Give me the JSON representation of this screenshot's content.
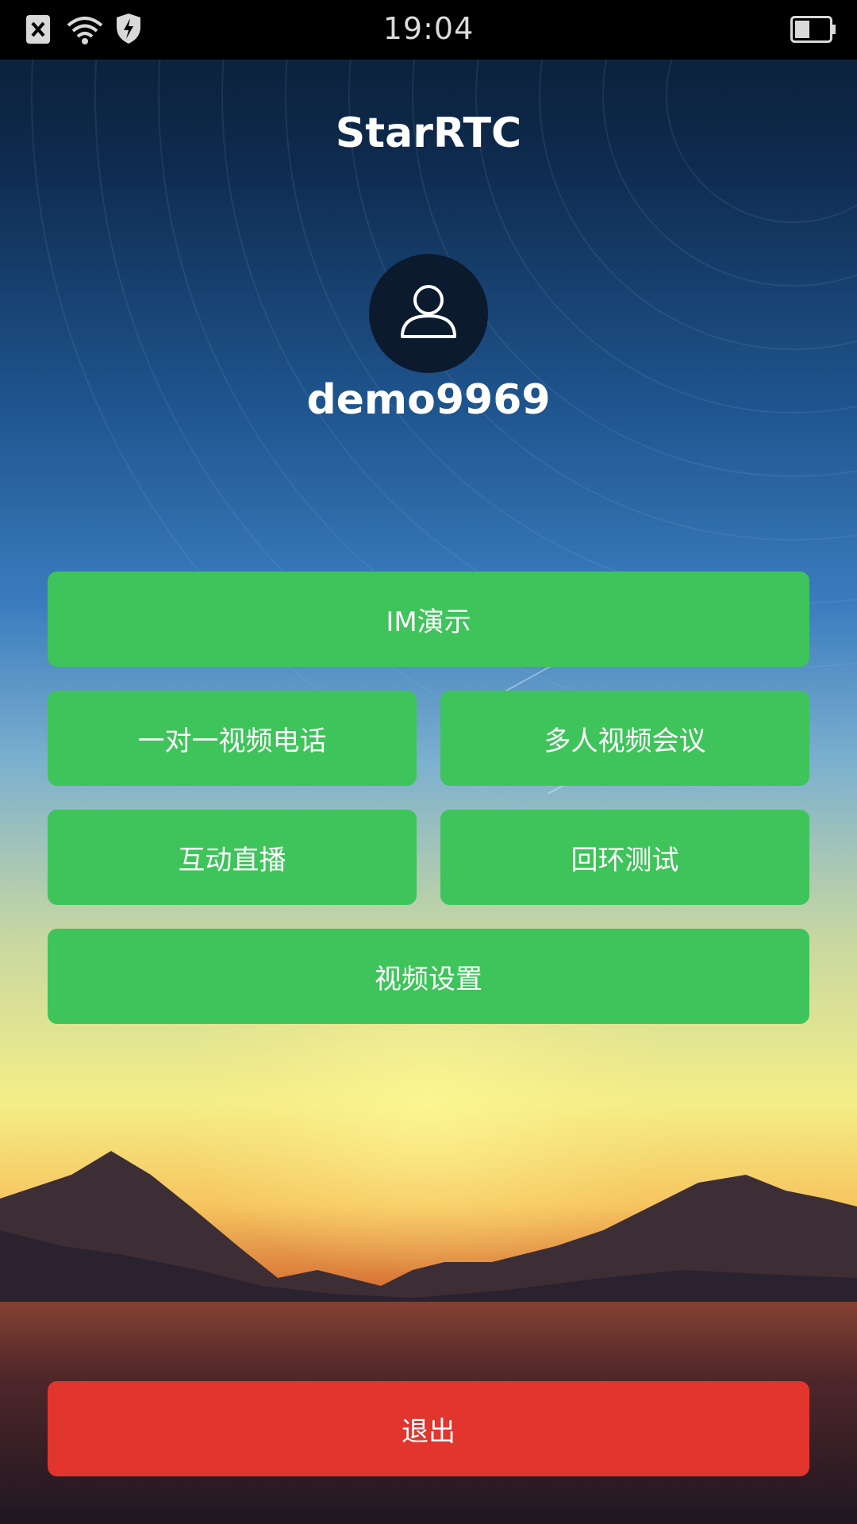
{
  "status_bar": {
    "time": "19:04",
    "icons": [
      "close-notification-icon",
      "wifi-icon",
      "shield-bolt-icon",
      "battery-icon"
    ]
  },
  "app": {
    "title": "StarRTC"
  },
  "user": {
    "avatar_icon": "user-icon",
    "username": "demo9969"
  },
  "menu": {
    "im_demo": "IM演示",
    "one_to_one_video": "一对一视频电话",
    "multi_video_meeting": "多人视频会议",
    "live_broadcast": "互动直播",
    "loopback_test": "回环测试",
    "video_settings": "视频设置"
  },
  "logout": {
    "label": "退出"
  },
  "colors": {
    "button_green": "#3ec45a",
    "button_red": "#e2352e",
    "text": "#ffffff"
  }
}
